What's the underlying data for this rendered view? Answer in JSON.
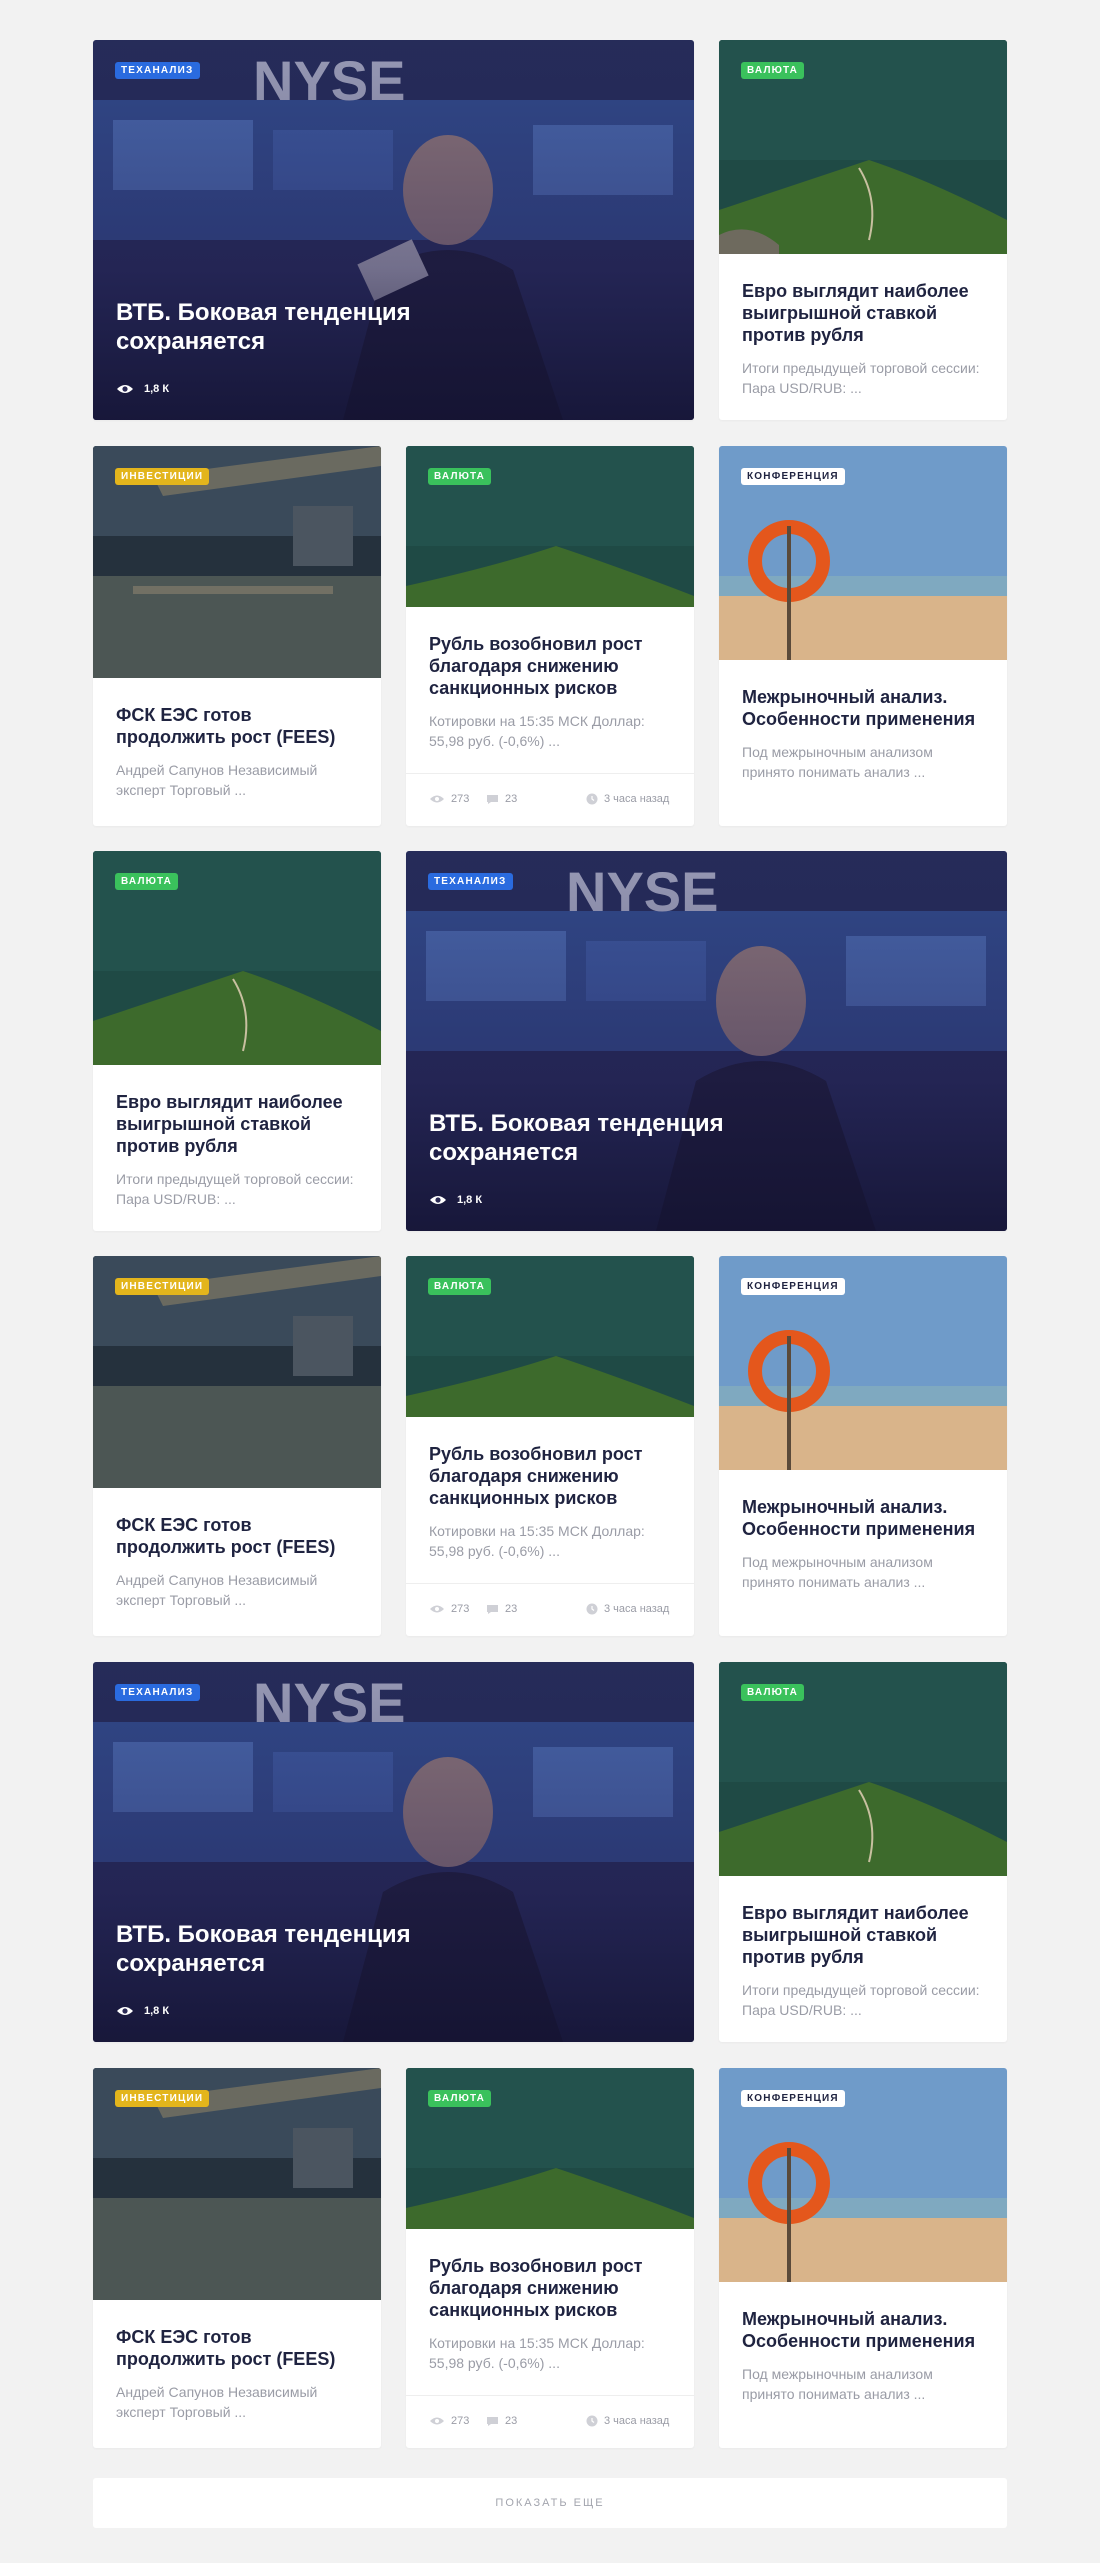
{
  "cards": {
    "tech_title": "ВТБ. Боковая тенденция сохраняется",
    "tech_badge": "Теханализ",
    "tech_views": "1,8 К",
    "euro_badge": "Валюта",
    "euro_title": "Евро выглядит наиболее выигрышной ставкой против рубля",
    "euro_excerpt": "Итоги предыдущей торговой сессии: Пара USD/RUB: ...",
    "fsk_badge": "Инвестиции",
    "fsk_title": "ФСК ЕЭС готов продолжить рост (FEES)",
    "fsk_excerpt": "Андрей Сапунов Независимый эксперт Торговый ...",
    "rub_badge": "Валюта",
    "rub_title": "Рубль возобновил рост благодаря снижению санкционных рисков",
    "rub_excerpt": "Котировки на 15:35 МСК Доллар: 55,98 руб. (-0,6%) ...",
    "rub_views": "273",
    "rub_comments": "23",
    "rub_time": "3 часа назад",
    "conf_badge": "Конференция",
    "conf_title": "Межрыночный анализ. Особенности применения",
    "conf_excerpt": "Под межрыночным анализом принято понимать анализ ..."
  },
  "load_more": "Показать еще"
}
